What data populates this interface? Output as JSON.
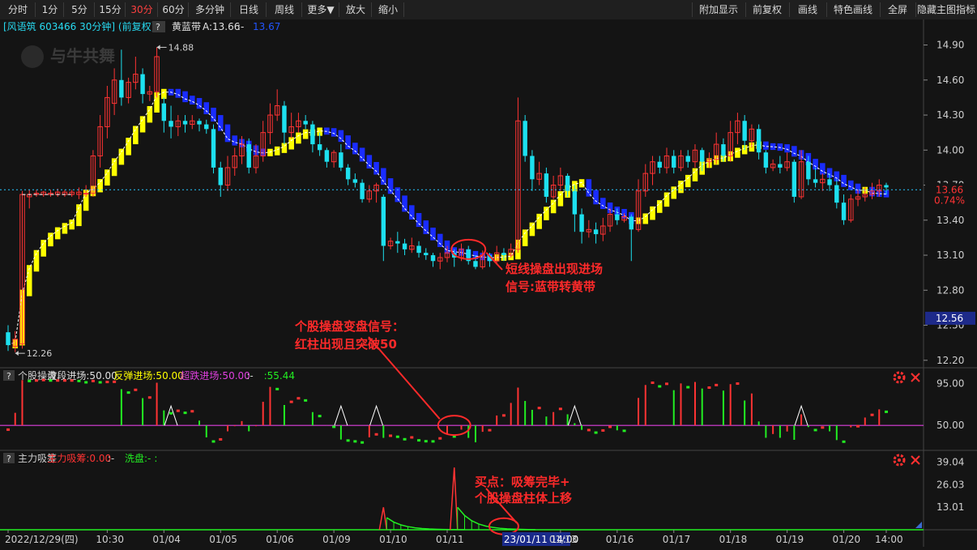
{
  "toolbar": {
    "left": [
      {
        "label": "分时"
      },
      {
        "label": "1分"
      },
      {
        "label": "5分"
      },
      {
        "label": "15分"
      },
      {
        "label": "30分",
        "active": true
      },
      {
        "label": "60分"
      },
      {
        "label": "多分钟"
      },
      {
        "label": "日线"
      },
      {
        "label": "周线"
      },
      {
        "label": "更多▼"
      },
      {
        "label": "放大"
      },
      {
        "label": "缩小"
      }
    ],
    "right": [
      {
        "label": "附加显示"
      },
      {
        "label": "前复权"
      },
      {
        "label": "画线"
      },
      {
        "label": "特色画线"
      },
      {
        "label": "全屏"
      },
      {
        "label": "隐藏主图指标"
      }
    ]
  },
  "header": {
    "stock": "[风语筑 603466 30分钟] (前复权)",
    "help": "?",
    "indicator_name": "黄蓝带",
    "indicator_a": "A:13.66",
    "indicator_sep": ":-",
    "indicator_b": "13.67"
  },
  "watermark": "与牛共舞",
  "colors": {
    "up": "#ff3333",
    "down": "#1de0ef",
    "yellow_band": "#ffff00",
    "blue_band": "#1a2cff",
    "green": "#22ee22",
    "magenta": "#e040e0",
    "annotation": "#ff2a2a",
    "price_tag": "#1e2a8a"
  },
  "chart_data": [
    {
      "type": "candlestick",
      "name": "main",
      "ylim": [
        12.15,
        14.98
      ],
      "y_ticks": [
        "14.90",
        "14.60",
        "14.30",
        "14.00",
        "13.70",
        "13.40",
        "13.10",
        "12.80",
        "12.50",
        "12.20"
      ],
      "x_labels": [
        {
          "i": 0,
          "label": "2022/12/29(四)"
        },
        {
          "i": 14,
          "label": "10:30"
        },
        {
          "i": 22,
          "label": "01/04"
        },
        {
          "i": 30,
          "label": "01/05"
        },
        {
          "i": 38,
          "label": "01/06"
        },
        {
          "i": 46,
          "label": "01/09"
        },
        {
          "i": 54,
          "label": "01/10"
        },
        {
          "i": 62,
          "label": "01/11"
        },
        {
          "i": 70,
          "label": "23/01/11 14:00",
          "highlight": true
        },
        {
          "i": 78,
          "label": "01/13"
        },
        {
          "i": 86,
          "label": "01/16"
        },
        {
          "i": 94,
          "label": "01/17"
        },
        {
          "i": 102,
          "label": "01/18"
        },
        {
          "i": 110,
          "label": "01/19"
        },
        {
          "i": 118,
          "label": "01/20"
        },
        {
          "i": 124,
          "label": "14:00"
        }
      ],
      "candles": [
        [
          12.44,
          12.33,
          12.5,
          12.28
        ],
        [
          12.32,
          12.38,
          12.45,
          12.27
        ],
        [
          12.34,
          13.62,
          13.65,
          12.3
        ],
        [
          13.6,
          13.62,
          13.66,
          13.5
        ],
        [
          13.62,
          13.63,
          13.66,
          13.6
        ],
        [
          13.62,
          13.64,
          13.65,
          13.6
        ],
        [
          13.62,
          13.63,
          13.66,
          13.6
        ],
        [
          13.62,
          13.64,
          13.67,
          13.6
        ],
        [
          13.62,
          13.64,
          13.66,
          13.6
        ],
        [
          13.62,
          13.64,
          13.66,
          13.6
        ],
        [
          13.62,
          13.64,
          13.68,
          13.58
        ],
        [
          13.63,
          13.63,
          13.7,
          13.6
        ],
        [
          13.63,
          13.95,
          14.0,
          13.6
        ],
        [
          13.95,
          14.2,
          14.3,
          13.85
        ],
        [
          14.2,
          14.45,
          14.55,
          14.1
        ],
        [
          14.4,
          14.6,
          14.7,
          14.3
        ],
        [
          14.6,
          14.45,
          14.86,
          14.38
        ],
        [
          14.45,
          14.58,
          14.62,
          14.4
        ],
        [
          14.58,
          14.65,
          14.8,
          14.52
        ],
        [
          14.65,
          14.48,
          14.7,
          14.4
        ],
        [
          14.48,
          14.5,
          14.55,
          14.42
        ],
        [
          14.5,
          14.8,
          14.88,
          14.45
        ],
        [
          14.4,
          14.25,
          14.45,
          14.15
        ],
        [
          14.25,
          14.2,
          14.38,
          14.1
        ],
        [
          14.2,
          14.25,
          14.3,
          14.12
        ],
        [
          14.25,
          14.22,
          14.3,
          14.15
        ],
        [
          14.22,
          14.25,
          14.3,
          14.18
        ],
        [
          14.25,
          14.22,
          14.27,
          14.16
        ],
        [
          14.22,
          14.18,
          14.26,
          14.14
        ],
        [
          14.18,
          13.85,
          14.22,
          13.8
        ],
        [
          13.85,
          13.7,
          13.9,
          13.6
        ],
        [
          13.7,
          13.85,
          13.95,
          13.65
        ],
        [
          13.85,
          13.95,
          14.02,
          13.78
        ],
        [
          13.95,
          14.05,
          14.12,
          13.88
        ],
        [
          14.05,
          13.85,
          14.1,
          13.8
        ],
        [
          13.85,
          13.95,
          14.05,
          13.8
        ],
        [
          13.95,
          14.15,
          14.25,
          13.9
        ],
        [
          14.15,
          14.3,
          14.4,
          14.05
        ],
        [
          14.3,
          14.38,
          14.52,
          14.25
        ],
        [
          14.38,
          14.15,
          14.42,
          14.05
        ],
        [
          14.15,
          14.2,
          14.32,
          14.1
        ],
        [
          14.2,
          14.25,
          14.32,
          14.15
        ],
        [
          14.25,
          14.22,
          14.3,
          14.18
        ],
        [
          14.22,
          14.05,
          14.25,
          13.98
        ],
        [
          14.05,
          14.0,
          14.15,
          13.95
        ],
        [
          14.0,
          13.9,
          14.02,
          13.85
        ],
        [
          13.9,
          13.98,
          14.0,
          13.85
        ],
        [
          13.98,
          13.85,
          14.05,
          13.82
        ],
        [
          13.85,
          13.75,
          13.88,
          13.7
        ],
        [
          13.75,
          13.72,
          13.8,
          13.68
        ],
        [
          13.72,
          13.58,
          13.75,
          13.55
        ],
        [
          13.58,
          13.65,
          13.7,
          13.55
        ],
        [
          13.65,
          13.7,
          13.72,
          13.55
        ],
        [
          13.6,
          13.18,
          13.62,
          13.05
        ],
        [
          13.18,
          13.22,
          13.25,
          13.15
        ],
        [
          13.22,
          13.2,
          13.3,
          13.12
        ],
        [
          13.2,
          13.15,
          13.24,
          13.1
        ],
        [
          13.15,
          13.18,
          13.25,
          13.12
        ],
        [
          13.18,
          13.12,
          13.22,
          13.08
        ],
        [
          13.12,
          13.1,
          13.16,
          13.06
        ],
        [
          13.1,
          13.05,
          13.12,
          13.0
        ],
        [
          13.05,
          13.08,
          13.12,
          12.98
        ],
        [
          13.08,
          13.12,
          13.18,
          13.04
        ],
        [
          13.12,
          13.08,
          13.15,
          13.0
        ],
        [
          13.08,
          13.15,
          13.2,
          13.05
        ],
        [
          13.15,
          13.05,
          13.18,
          13.02
        ],
        [
          13.05,
          13.0,
          13.1,
          12.98
        ],
        [
          13.0,
          13.1,
          13.14,
          12.98
        ],
        [
          13.1,
          13.05,
          13.12,
          13.0
        ],
        [
          13.05,
          13.12,
          13.18,
          13.02
        ],
        [
          13.12,
          13.1,
          13.16,
          13.05
        ],
        [
          13.1,
          13.15,
          13.2,
          13.08
        ],
        [
          13.15,
          14.25,
          14.45,
          13.12
        ],
        [
          14.25,
          13.95,
          14.3,
          13.9
        ],
        [
          13.95,
          13.75,
          14.0,
          13.65
        ],
        [
          13.75,
          13.8,
          13.9,
          13.7
        ],
        [
          13.8,
          13.6,
          13.85,
          13.55
        ],
        [
          13.6,
          13.7,
          13.78,
          13.58
        ],
        [
          13.7,
          13.78,
          13.85,
          13.65
        ],
        [
          13.78,
          13.65,
          13.8,
          13.6
        ],
        [
          13.65,
          13.45,
          13.7,
          13.3
        ],
        [
          13.45,
          13.3,
          13.5,
          13.2
        ],
        [
          13.3,
          13.32,
          13.4,
          13.25
        ],
        [
          13.32,
          13.28,
          13.38,
          13.2
        ],
        [
          13.28,
          13.35,
          13.42,
          13.22
        ],
        [
          13.35,
          13.45,
          13.5,
          13.3
        ],
        [
          13.45,
          13.4,
          13.5,
          13.36
        ],
        [
          13.4,
          13.43,
          13.46,
          13.38
        ],
        [
          13.43,
          13.32,
          13.45,
          13.05
        ],
        [
          13.32,
          13.65,
          13.75,
          13.3
        ],
        [
          13.65,
          13.8,
          13.88,
          13.6
        ],
        [
          13.8,
          13.9,
          13.95,
          13.7
        ],
        [
          13.9,
          13.85,
          13.95,
          13.8
        ],
        [
          13.85,
          13.95,
          14.02,
          13.8
        ],
        [
          13.95,
          13.85,
          14.0,
          13.8
        ],
        [
          13.85,
          13.95,
          14.0,
          13.82
        ],
        [
          13.95,
          13.9,
          14.0,
          13.85
        ],
        [
          13.9,
          14.0,
          14.05,
          13.85
        ],
        [
          14.0,
          13.9,
          14.02,
          13.82
        ],
        [
          13.9,
          13.92,
          13.98,
          13.85
        ],
        [
          13.92,
          14.05,
          14.15,
          13.88
        ],
        [
          14.05,
          13.95,
          14.1,
          13.9
        ],
        [
          13.95,
          14.15,
          14.25,
          13.9
        ],
        [
          14.15,
          14.25,
          14.32,
          14.05
        ],
        [
          14.25,
          14.08,
          14.3,
          14.0
        ],
        [
          14.08,
          14.18,
          14.22,
          14.02
        ],
        [
          14.18,
          13.98,
          14.22,
          13.92
        ],
        [
          13.98,
          13.85,
          14.0,
          13.8
        ],
        [
          13.85,
          13.88,
          13.92,
          13.82
        ],
        [
          13.88,
          13.85,
          13.95,
          13.8
        ],
        [
          13.85,
          13.9,
          13.98,
          13.82
        ],
        [
          13.9,
          13.6,
          13.92,
          13.55
        ],
        [
          13.6,
          13.9,
          14.0,
          13.58
        ],
        [
          13.9,
          13.75,
          13.95,
          13.7
        ],
        [
          13.75,
          13.72,
          13.85,
          13.68
        ],
        [
          13.72,
          13.75,
          13.8,
          13.65
        ],
        [
          13.75,
          13.7,
          13.8,
          13.65
        ],
        [
          13.7,
          13.55,
          13.75,
          13.5
        ],
        [
          13.55,
          13.4,
          13.62,
          13.36
        ],
        [
          13.4,
          13.58,
          13.62,
          13.38
        ],
        [
          13.58,
          13.6,
          13.66,
          13.52
        ],
        [
          13.6,
          13.62,
          13.68,
          13.56
        ],
        [
          13.62,
          13.65,
          13.72,
          13.58
        ],
        [
          13.65,
          13.7,
          13.75,
          13.6
        ],
        [
          13.7,
          13.68,
          13.72,
          13.62
        ]
      ],
      "annotations": [
        {
          "label": "14.88",
          "i": 21,
          "price": 14.88
        },
        {
          "label": "12.26",
          "i": 1,
          "price": 12.26
        }
      ],
      "price_tags": [
        {
          "label": "13.66",
          "price": 13.66,
          "style": "current"
        },
        {
          "label": "0.74%",
          "price": 13.57,
          "style": "percent"
        },
        {
          "label": "12.56",
          "price": 12.56,
          "style": "box"
        }
      ],
      "signal_text": [
        "短线操盘出现进场",
        "信号:蓝带转黄带"
      ]
    },
    {
      "type": "line",
      "name": "个股操盘",
      "legend": [
        {
          "label": "个股操盘",
          "color": "#cfcfcf"
        },
        {
          "label": "波段进场:50.00",
          "color": "#e0e0e0"
        },
        {
          "label": "反弹进场:50.00",
          "color": "#ffff00"
        },
        {
          "label": "超跌进场:50.00",
          "color": "#e040e0"
        },
        {
          "label": ":-",
          "color": "#cfcfcf"
        },
        {
          "label": ":55.44",
          "color": "#22ee22"
        }
      ],
      "ylim": [
        25,
        110
      ],
      "y_ticks": [
        "95.00",
        "50.00"
      ],
      "baseline": 50,
      "triangles": [
        23,
        47,
        52,
        80,
        112
      ],
      "signal_text": [
        "个股操盘变盘信号：",
        "红柱出现且突破50"
      ]
    },
    {
      "type": "bar",
      "name": "主力吸筹",
      "legend": [
        {
          "label": "主力吸筹",
          "color": "#cfcfcf"
        },
        {
          "label": "主力吸筹:0.00",
          "color": "#ff3333"
        },
        {
          "label": ":-",
          "color": "#cfcfcf"
        },
        {
          "label": "洗盘:-",
          "color": "#22ee22"
        },
        {
          "label": ":",
          "color": "#22ee22"
        }
      ],
      "ylim": [
        0,
        45
      ],
      "y_ticks": [
        "39.04",
        "26.03",
        "13.01"
      ],
      "signal_text": [
        "买点：吸筹完毕+",
        "个股操盘柱体上移"
      ]
    }
  ]
}
